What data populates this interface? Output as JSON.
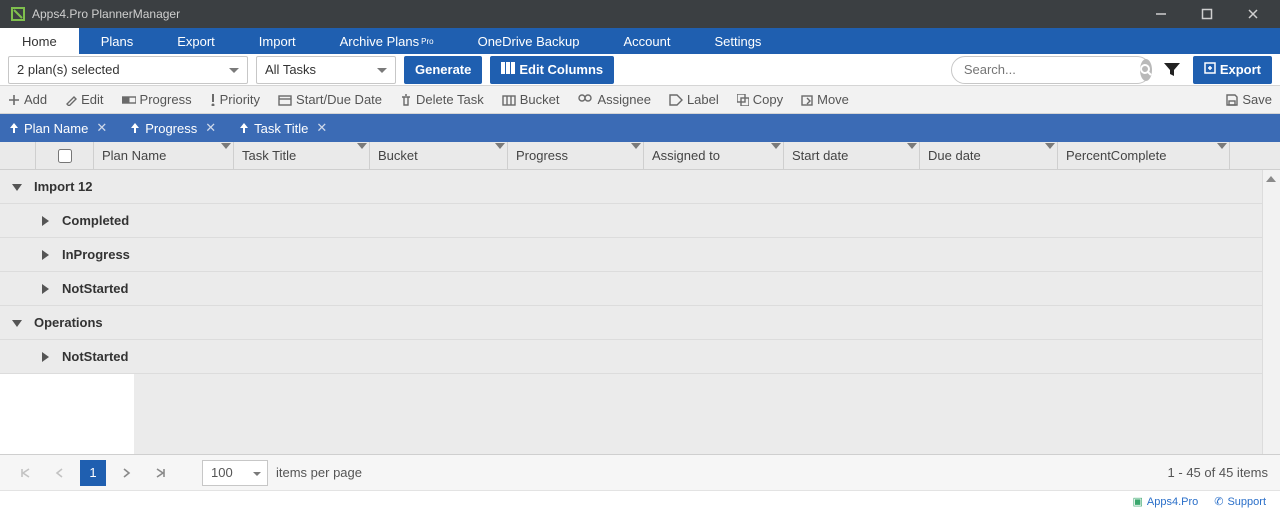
{
  "app": {
    "title": "Apps4.Pro PlannerManager"
  },
  "nav": {
    "tabs": [
      {
        "label": "Home",
        "active": true
      },
      {
        "label": "Plans"
      },
      {
        "label": "Export"
      },
      {
        "label": "Import"
      },
      {
        "label": "Archive Plans",
        "badge": "Pro"
      },
      {
        "label": "OneDrive Backup"
      },
      {
        "label": "Account"
      },
      {
        "label": "Settings"
      }
    ]
  },
  "toolbar": {
    "plan_select": "2 plan(s) selected",
    "task_filter": "All Tasks",
    "generate": "Generate",
    "edit_columns": "Edit Columns",
    "search_placeholder": "Search...",
    "export": "Export"
  },
  "actions": {
    "add": "Add",
    "edit": "Edit",
    "progress": "Progress",
    "priority": "Priority",
    "startdue": "Start/Due Date",
    "delete": "Delete Task",
    "bucket": "Bucket",
    "assignee": "Assignee",
    "label": "Label",
    "copy": "Copy",
    "move": "Move",
    "save": "Save"
  },
  "groupby": {
    "chips": [
      {
        "label": "Plan Name"
      },
      {
        "label": "Progress"
      },
      {
        "label": "Task Title"
      }
    ]
  },
  "columns": {
    "plan_name": "Plan Name",
    "task_title": "Task Title",
    "bucket": "Bucket",
    "progress": "Progress",
    "assigned": "Assigned to",
    "start": "Start date",
    "due": "Due date",
    "percent": "PercentComplete"
  },
  "column_widths": {
    "expand": 36,
    "check": 58,
    "plan_name": 140,
    "task_title": 136,
    "bucket": 138,
    "progress": 136,
    "assigned": 140,
    "start": 136,
    "due": 138,
    "percent": 172
  },
  "rows": [
    {
      "level": 0,
      "expanded": true,
      "label": "Import 12"
    },
    {
      "level": 1,
      "expanded": false,
      "label": "Completed"
    },
    {
      "level": 1,
      "expanded": false,
      "label": "InProgress"
    },
    {
      "level": 1,
      "expanded": false,
      "label": "NotStarted"
    },
    {
      "level": 0,
      "expanded": true,
      "label": "Operations"
    },
    {
      "level": 1,
      "expanded": false,
      "label": "NotStarted"
    }
  ],
  "pager": {
    "page": "1",
    "page_size": "100",
    "per_page_label": "items per page",
    "summary": "1 - 45 of 45 items"
  },
  "footer": {
    "brand": "Apps4.Pro",
    "support": "Support"
  }
}
